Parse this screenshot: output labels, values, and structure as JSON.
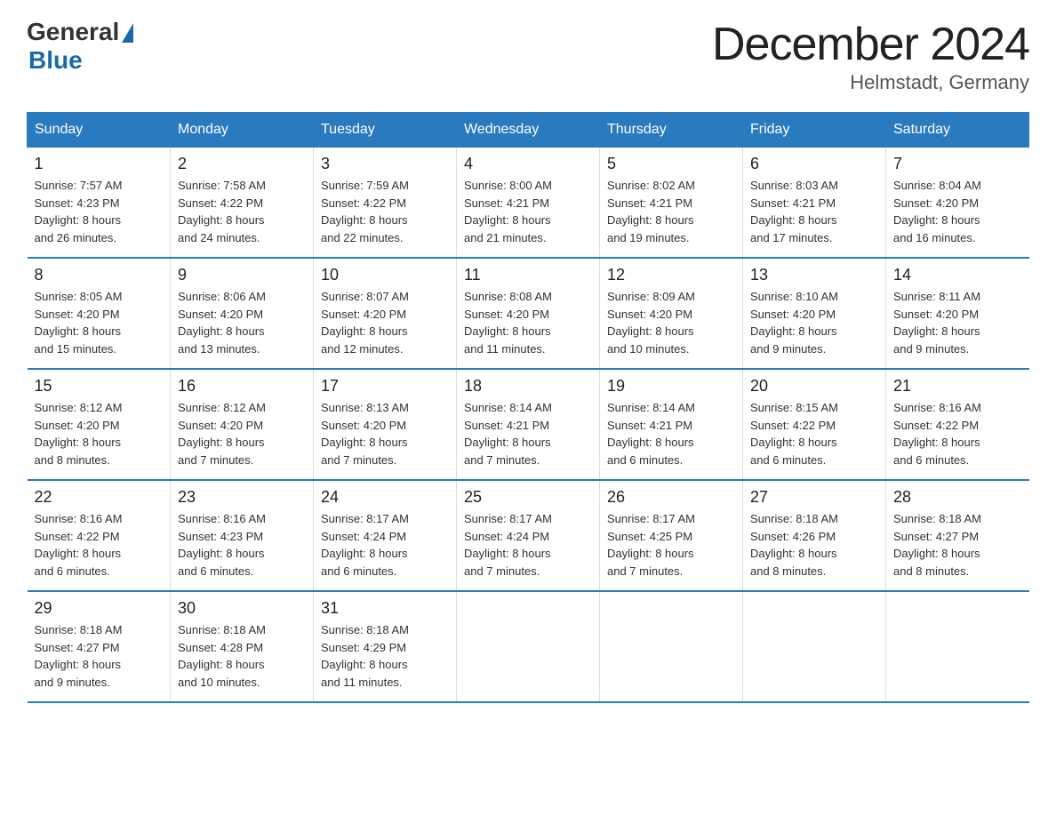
{
  "header": {
    "title": "December 2024",
    "subtitle": "Helmstadt, Germany",
    "logo_general": "General",
    "logo_blue": "Blue"
  },
  "days_of_week": [
    "Sunday",
    "Monday",
    "Tuesday",
    "Wednesday",
    "Thursday",
    "Friday",
    "Saturday"
  ],
  "weeks": [
    [
      {
        "num": "1",
        "sunrise": "7:57 AM",
        "sunset": "4:23 PM",
        "daylight": "8 hours and 26 minutes."
      },
      {
        "num": "2",
        "sunrise": "7:58 AM",
        "sunset": "4:22 PM",
        "daylight": "8 hours and 24 minutes."
      },
      {
        "num": "3",
        "sunrise": "7:59 AM",
        "sunset": "4:22 PM",
        "daylight": "8 hours and 22 minutes."
      },
      {
        "num": "4",
        "sunrise": "8:00 AM",
        "sunset": "4:21 PM",
        "daylight": "8 hours and 21 minutes."
      },
      {
        "num": "5",
        "sunrise": "8:02 AM",
        "sunset": "4:21 PM",
        "daylight": "8 hours and 19 minutes."
      },
      {
        "num": "6",
        "sunrise": "8:03 AM",
        "sunset": "4:21 PM",
        "daylight": "8 hours and 17 minutes."
      },
      {
        "num": "7",
        "sunrise": "8:04 AM",
        "sunset": "4:20 PM",
        "daylight": "8 hours and 16 minutes."
      }
    ],
    [
      {
        "num": "8",
        "sunrise": "8:05 AM",
        "sunset": "4:20 PM",
        "daylight": "8 hours and 15 minutes."
      },
      {
        "num": "9",
        "sunrise": "8:06 AM",
        "sunset": "4:20 PM",
        "daylight": "8 hours and 13 minutes."
      },
      {
        "num": "10",
        "sunrise": "8:07 AM",
        "sunset": "4:20 PM",
        "daylight": "8 hours and 12 minutes."
      },
      {
        "num": "11",
        "sunrise": "8:08 AM",
        "sunset": "4:20 PM",
        "daylight": "8 hours and 11 minutes."
      },
      {
        "num": "12",
        "sunrise": "8:09 AM",
        "sunset": "4:20 PM",
        "daylight": "8 hours and 10 minutes."
      },
      {
        "num": "13",
        "sunrise": "8:10 AM",
        "sunset": "4:20 PM",
        "daylight": "8 hours and 9 minutes."
      },
      {
        "num": "14",
        "sunrise": "8:11 AM",
        "sunset": "4:20 PM",
        "daylight": "8 hours and 9 minutes."
      }
    ],
    [
      {
        "num": "15",
        "sunrise": "8:12 AM",
        "sunset": "4:20 PM",
        "daylight": "8 hours and 8 minutes."
      },
      {
        "num": "16",
        "sunrise": "8:12 AM",
        "sunset": "4:20 PM",
        "daylight": "8 hours and 7 minutes."
      },
      {
        "num": "17",
        "sunrise": "8:13 AM",
        "sunset": "4:20 PM",
        "daylight": "8 hours and 7 minutes."
      },
      {
        "num": "18",
        "sunrise": "8:14 AM",
        "sunset": "4:21 PM",
        "daylight": "8 hours and 7 minutes."
      },
      {
        "num": "19",
        "sunrise": "8:14 AM",
        "sunset": "4:21 PM",
        "daylight": "8 hours and 6 minutes."
      },
      {
        "num": "20",
        "sunrise": "8:15 AM",
        "sunset": "4:22 PM",
        "daylight": "8 hours and 6 minutes."
      },
      {
        "num": "21",
        "sunrise": "8:16 AM",
        "sunset": "4:22 PM",
        "daylight": "8 hours and 6 minutes."
      }
    ],
    [
      {
        "num": "22",
        "sunrise": "8:16 AM",
        "sunset": "4:22 PM",
        "daylight": "8 hours and 6 minutes."
      },
      {
        "num": "23",
        "sunrise": "8:16 AM",
        "sunset": "4:23 PM",
        "daylight": "8 hours and 6 minutes."
      },
      {
        "num": "24",
        "sunrise": "8:17 AM",
        "sunset": "4:24 PM",
        "daylight": "8 hours and 6 minutes."
      },
      {
        "num": "25",
        "sunrise": "8:17 AM",
        "sunset": "4:24 PM",
        "daylight": "8 hours and 7 minutes."
      },
      {
        "num": "26",
        "sunrise": "8:17 AM",
        "sunset": "4:25 PM",
        "daylight": "8 hours and 7 minutes."
      },
      {
        "num": "27",
        "sunrise": "8:18 AM",
        "sunset": "4:26 PM",
        "daylight": "8 hours and 8 minutes."
      },
      {
        "num": "28",
        "sunrise": "8:18 AM",
        "sunset": "4:27 PM",
        "daylight": "8 hours and 8 minutes."
      }
    ],
    [
      {
        "num": "29",
        "sunrise": "8:18 AM",
        "sunset": "4:27 PM",
        "daylight": "8 hours and 9 minutes."
      },
      {
        "num": "30",
        "sunrise": "8:18 AM",
        "sunset": "4:28 PM",
        "daylight": "8 hours and 10 minutes."
      },
      {
        "num": "31",
        "sunrise": "8:18 AM",
        "sunset": "4:29 PM",
        "daylight": "8 hours and 11 minutes."
      },
      null,
      null,
      null,
      null
    ]
  ],
  "labels": {
    "sunrise": "Sunrise:",
    "sunset": "Sunset:",
    "daylight": "Daylight:"
  }
}
